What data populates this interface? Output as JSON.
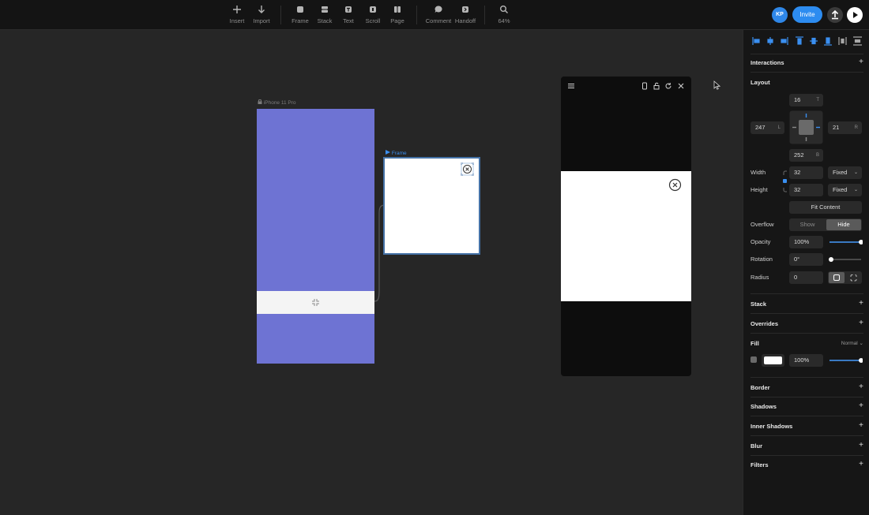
{
  "toolbar": {
    "items": [
      {
        "label": "Insert",
        "icon": "plus-icon"
      },
      {
        "label": "Import",
        "icon": "arrow-down-icon"
      },
      {
        "label": "Frame",
        "icon": "frame-icon"
      },
      {
        "label": "Stack",
        "icon": "stack-icon"
      },
      {
        "label": "Text",
        "icon": "text-icon"
      },
      {
        "label": "Scroll",
        "icon": "scroll-icon"
      },
      {
        "label": "Page",
        "icon": "page-icon"
      },
      {
        "label": "Comment",
        "icon": "comment-icon"
      },
      {
        "label": "Handoff",
        "icon": "handoff-icon"
      },
      {
        "label": "64%",
        "icon": "zoom-icon"
      }
    ],
    "avatar_initials": "KP",
    "invite_label": "Invite"
  },
  "canvas": {
    "phone_label": "iPhone 11 Pro",
    "phone_color": "#6e73d3",
    "frame_label": "Frame",
    "frame_selection_color": "#4471a6"
  },
  "panel": {
    "interactions": "Interactions",
    "layout": "Layout",
    "pos_top": "16",
    "pos_top_suffix": "T",
    "pos_left": "247",
    "pos_left_suffix": "L",
    "pos_right": "21",
    "pos_right_suffix": "R",
    "pos_bottom": "252",
    "pos_bottom_suffix": "B",
    "width_label": "Width",
    "width_value": "32",
    "width_mode": "Fixed",
    "height_label": "Height",
    "height_value": "32",
    "height_mode": "Fixed",
    "fit_content": "Fit Content",
    "overflow_label": "Overflow",
    "overflow_show": "Show",
    "overflow_hide": "Hide",
    "opacity_label": "Opacity",
    "opacity_value": "100%",
    "opacity_level": 1.0,
    "rotation_label": "Rotation",
    "rotation_value": "0°",
    "radius_label": "Radius",
    "radius_value": "0",
    "stack": "Stack",
    "overrides": "Overrides",
    "fill": "Fill",
    "fill_blend": "Normal",
    "fill_color": "#ffffff",
    "fill_opacity": "100%",
    "fill_level": 1.0,
    "border": "Border",
    "shadows": "Shadows",
    "inner_shadows": "Inner Shadows",
    "blur": "Blur",
    "filters": "Filters"
  },
  "accent_color": "#2d8cf0"
}
